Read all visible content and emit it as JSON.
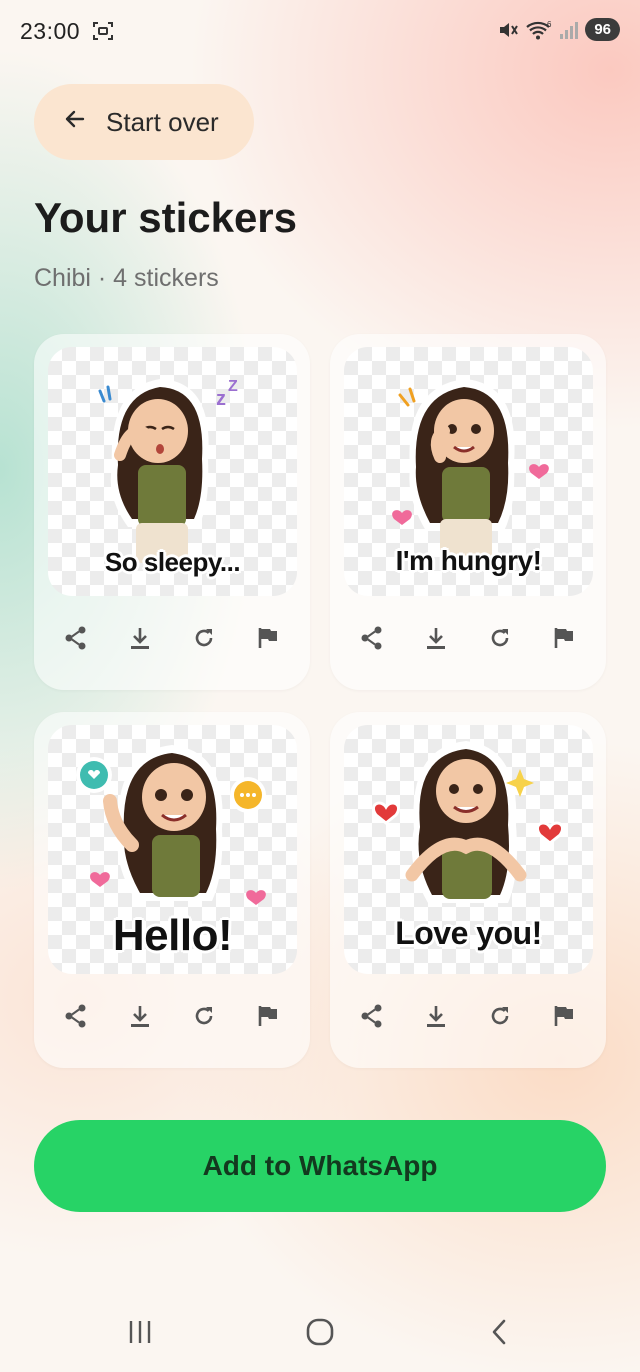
{
  "status_bar": {
    "time": "23:00",
    "battery": "96",
    "icons": [
      "screenshot-icon",
      "mute-icon",
      "wifi-icon",
      "signal-icon"
    ]
  },
  "header": {
    "back_label": "Start over",
    "title": "Your stickers",
    "subtitle": "Chibi · 4 stickers"
  },
  "stickers": [
    {
      "caption": "So sleepy...",
      "actions": [
        "share-icon",
        "download-icon",
        "regenerate-icon",
        "report-icon"
      ]
    },
    {
      "caption": "I'm hungry!",
      "actions": [
        "share-icon",
        "download-icon",
        "regenerate-icon",
        "report-icon"
      ]
    },
    {
      "caption": "Hello!",
      "actions": [
        "share-icon",
        "download-icon",
        "regenerate-icon",
        "report-icon"
      ]
    },
    {
      "caption": "Love you!",
      "actions": [
        "share-icon",
        "download-icon",
        "regenerate-icon",
        "report-icon"
      ]
    }
  ],
  "primary_action": {
    "label": "Add to WhatsApp",
    "color": "#27d366"
  },
  "nav_bar": {
    "buttons": [
      "recents-icon",
      "home-icon",
      "back-icon"
    ]
  },
  "colors": {
    "accent_green": "#27d366",
    "chip_bg": "#fbe5d0",
    "shirt": "#6f7a3a",
    "hair": "#3a2418"
  }
}
